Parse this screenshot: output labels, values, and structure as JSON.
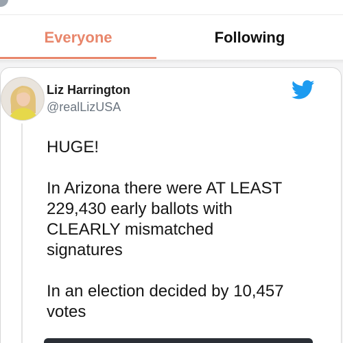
{
  "tabs": [
    {
      "label": "Everyone",
      "active": true
    },
    {
      "label": "Following",
      "active": false
    }
  ],
  "colors": {
    "accent": "#e8866b",
    "twitter_blue": "#1d9bf0",
    "text": "#151515",
    "muted": "#6b7580"
  },
  "tweet": {
    "author_name": "Liz Harrington",
    "author_handle": "@realLizUSA",
    "source_icon": "twitter-bird-icon",
    "text_lines": [
      "HUGE!",
      "",
      "In Arizona there were AT LEAST",
      "229,430 early ballots with",
      "CLEARLY mismatched",
      "signatures",
      "",
      "In an election decided by 10,457",
      "votes"
    ]
  }
}
